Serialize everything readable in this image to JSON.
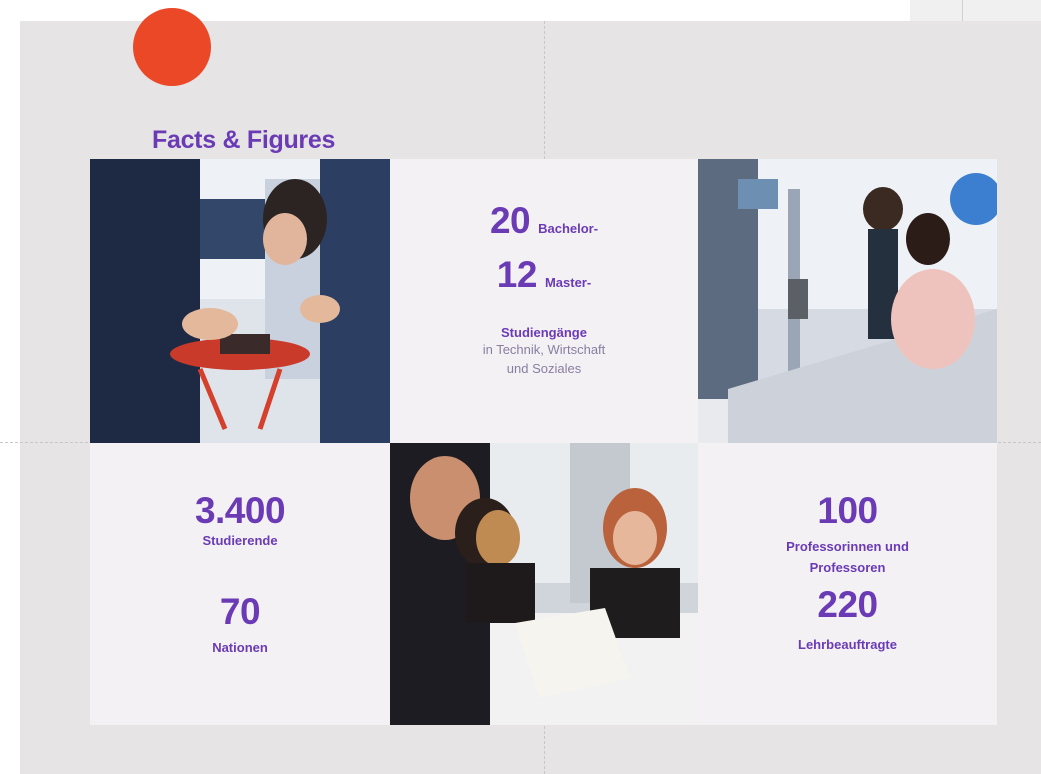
{
  "slide": {
    "title": "Facts & Figures",
    "accent_color": "#ea4827",
    "brand_color": "#6a3bb5"
  },
  "programs": {
    "bachelor_count": "20",
    "bachelor_label": "Bachelor-",
    "master_count": "12",
    "master_label": "Master-",
    "studies_label": "Studiengänge",
    "fields_line1": "in Technik, Wirtschaft",
    "fields_line2": "und Soziales"
  },
  "students": {
    "count": "3.400",
    "label": "Studierende",
    "nations_count": "70",
    "nations_label": "Nationen"
  },
  "faculty": {
    "professors_count": "100",
    "professors_label_line1": "Professorinnen und",
    "professors_label_line2": "Professoren",
    "lecturers_count": "220",
    "lecturers_label": "Lehrbeauftragte"
  },
  "photos": [
    {
      "name": "photo-student-drone"
    },
    {
      "name": "photo-lab-work"
    },
    {
      "name": "photo-students-meeting"
    }
  ]
}
